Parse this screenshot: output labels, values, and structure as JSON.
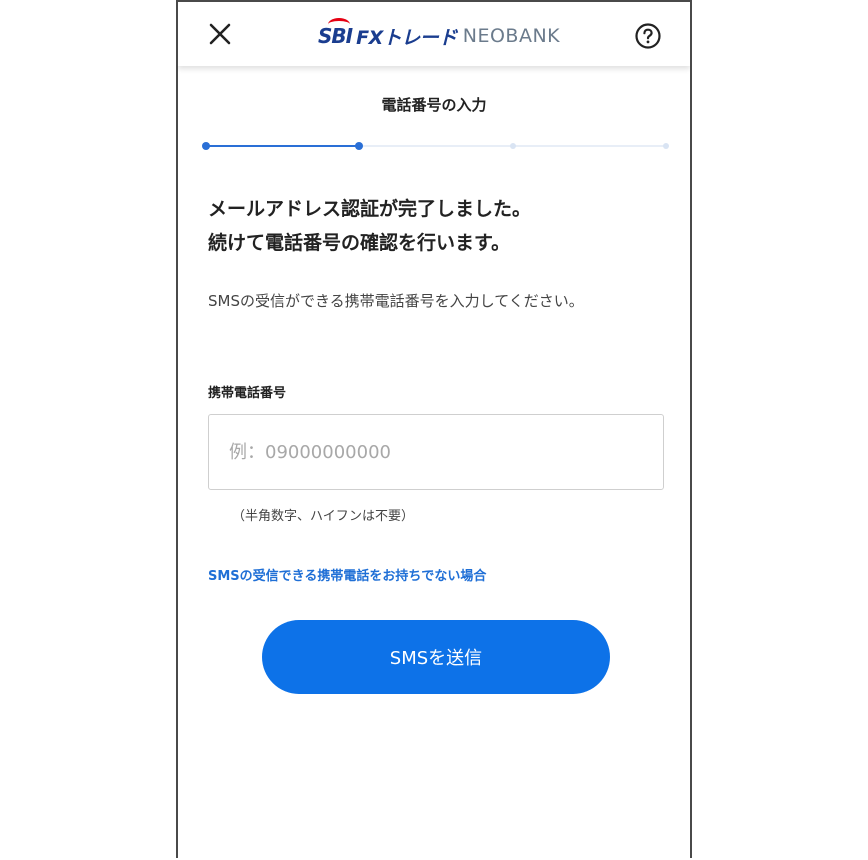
{
  "header": {
    "close_icon": "close-icon",
    "help_icon": "help-circle-icon",
    "logo": {
      "mark": "SBI",
      "product": "FXトレード",
      "suffix": "NEOBANK",
      "colors": {
        "mark": "#1a3d8f",
        "swoosh": "#e60012",
        "suffix": "#6b7b8c"
      }
    }
  },
  "step": {
    "title": "電話番号の入力",
    "progress": {
      "total_steps": 4,
      "current_step": 2,
      "active_color": "#2a6fd6",
      "inactive_color": "#d9e4f3"
    }
  },
  "main": {
    "headline_line1": "メールアドレス認証が完了しました。",
    "headline_line2": "続けて電話番号の確認を行います。",
    "description": "SMSの受信ができる携帯電話番号を入力してください。",
    "phone_field": {
      "label": "携帯電話番号",
      "placeholder": "例：09000000000",
      "value": "",
      "hint": "（半角数字、ハイフンは不要）"
    },
    "no_sms_link": "SMSの受信できる携帯電話をお持ちでない場合",
    "send_button": "SMSを送信"
  },
  "colors": {
    "accent": "#0d72e8",
    "link": "#1f6fd6",
    "text": "#222222"
  }
}
